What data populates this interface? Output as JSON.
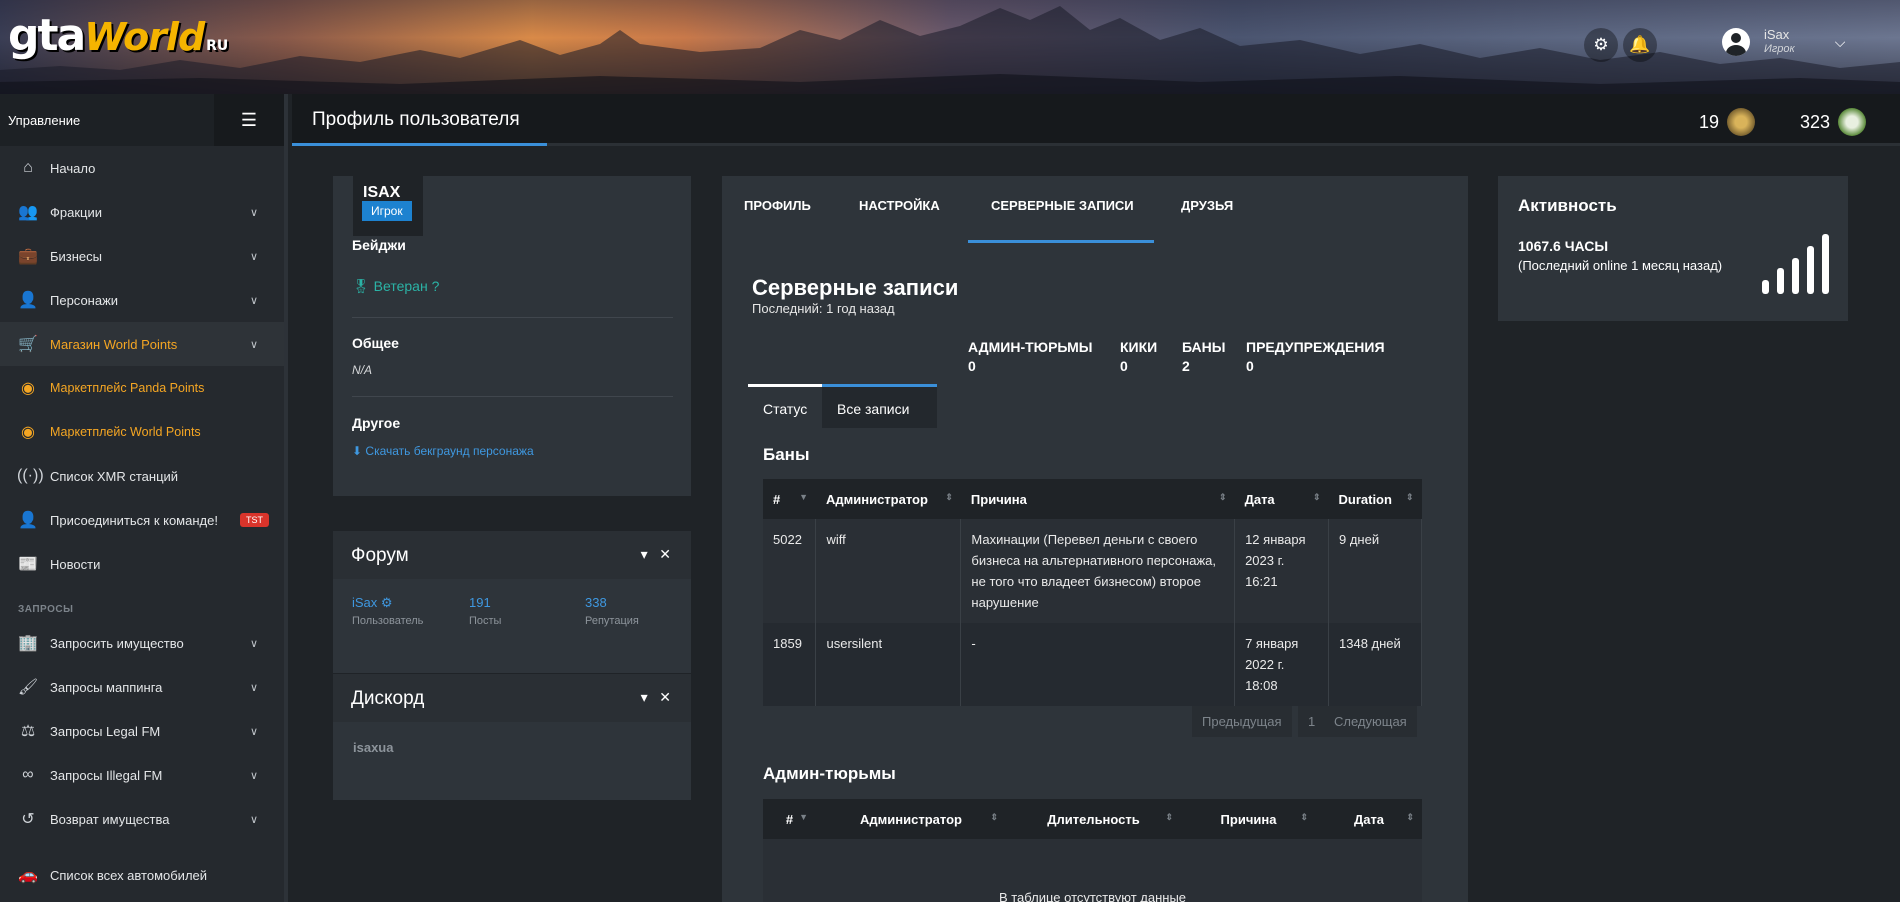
{
  "header": {
    "logo_main": "gta",
    "logo_script": "World",
    "logo_suffix": "RU",
    "user_name": "iSax",
    "user_role": "Игрок",
    "settings_icon": "gear-icon",
    "notify_icon": "bell-icon"
  },
  "sidebar": {
    "title": "Управление",
    "items": [
      {
        "label": "Начало",
        "icon": "home-icon"
      },
      {
        "label": "Фракции",
        "icon": "users-icon"
      },
      {
        "label": "Бизнесы",
        "icon": "briefcase-icon"
      },
      {
        "label": "Персонажи",
        "icon": "user-icon"
      },
      {
        "label": "Магазин World Points",
        "icon": "cart-icon"
      },
      {
        "label": "Маркетплейс Panda Points",
        "icon": "coins-icon"
      },
      {
        "label": "Маркетплейс World Points",
        "icon": "coins-icon"
      },
      {
        "label": "Список XMR станций",
        "icon": "antenna-icon"
      },
      {
        "label": "Присоединиться к команде!",
        "icon": "user-tie-icon",
        "badge": "TST"
      },
      {
        "label": "Новости",
        "icon": "newspaper-icon"
      }
    ],
    "section_label": "ЗАПРОСЫ",
    "request_items": [
      {
        "label": "Запросить имущество",
        "icon": "building-icon"
      },
      {
        "label": "Запросы маппинга",
        "icon": "brush-icon"
      },
      {
        "label": "Запросы Legal FM",
        "icon": "scale-icon"
      },
      {
        "label": "Запросы Illegal FM",
        "icon": "mask-icon"
      },
      {
        "label": "Возврат имущества",
        "icon": "undo-icon"
      }
    ],
    "last_item": {
      "label": "Список всех автомобилей",
      "icon": "car-icon"
    }
  },
  "topbar": {
    "title": "Профиль пользователя",
    "counter1": "19",
    "counter2": "323"
  },
  "profile": {
    "name": "ISAX",
    "role": "Игрок",
    "badges_title": "Бейджи",
    "badge": "Ветеран",
    "general_title": "Общее",
    "general_value": "N/A",
    "other_title": "Другое",
    "download_link": "Скачать бекграунд персонажа"
  },
  "forum": {
    "title": "Форум",
    "user": "iSax",
    "user_label": "Пользователь",
    "posts": "191",
    "posts_label": "Посты",
    "rep": "338",
    "rep_label": "Репутация"
  },
  "discord": {
    "title": "Дискорд",
    "value": "isaxua"
  },
  "tabs": [
    "ПРОФИЛЬ",
    "НАСТРОЙКА",
    "СЕРВЕРНЫЕ ЗАПИСИ",
    "ДРУЗЬЯ"
  ],
  "records": {
    "title": "Серверные записи",
    "last": "Последний: 1 год назад",
    "stats": [
      {
        "label": "АДМИН-ТЮРЬМЫ",
        "value": "0"
      },
      {
        "label": "КИКИ",
        "value": "0"
      },
      {
        "label": "БАНЫ",
        "value": "2"
      },
      {
        "label": "ПРЕДУПРЕЖДЕНИЯ",
        "value": "0"
      }
    ],
    "subtabs": [
      "Статус",
      "Все записи"
    ],
    "bans_title": "Баны",
    "bans_columns": [
      "#",
      "Администратор",
      "Причина",
      "Дата",
      "Duration"
    ],
    "bans": [
      {
        "id": "5022",
        "admin": "wiff",
        "reason": "Махинации (Перевел деньги с своего бизнеса на альтернативного персонажа, не того что владеет бизнесом) второе нарушение",
        "date": "12 января 2023 г. 16:21",
        "duration": "9 дней"
      },
      {
        "id": "1859",
        "admin": "usersilent",
        "reason": "-",
        "date": "7 января 2022 г. 18:08",
        "duration": "1348 дней"
      }
    ],
    "pager": {
      "prev": "Предыдущая",
      "page": "1",
      "next": "Следующая"
    },
    "jail_title": "Админ-тюрьмы",
    "jail_columns": [
      "#",
      "Администратор",
      "Длительность",
      "Причина",
      "Дата"
    ],
    "jail_empty": "В таблице отсутствуют данные"
  },
  "activity": {
    "title": "Активность",
    "hours": "1067.6 ЧАСЫ",
    "last_online": "(Последний online 1 месяц назад)"
  }
}
